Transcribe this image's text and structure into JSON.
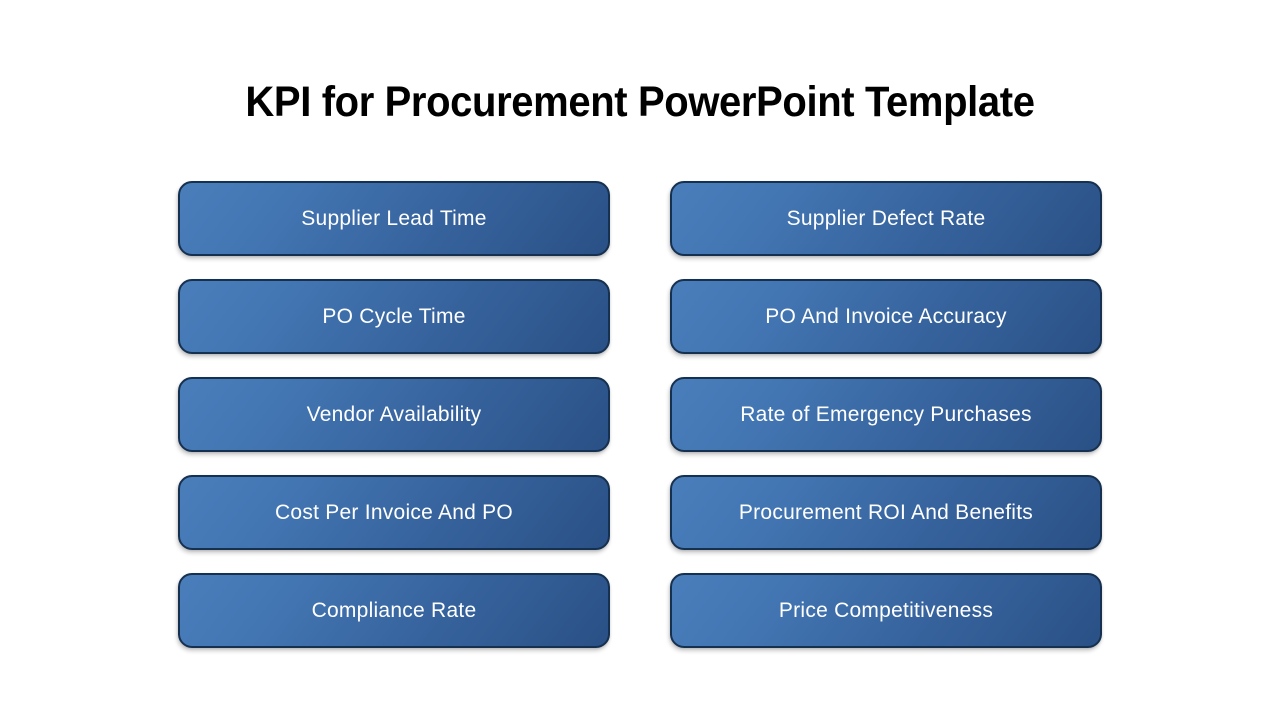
{
  "slide": {
    "title": "KPI for Procurement PowerPoint Template",
    "background_color": "#ffffff",
    "title_color": "#000000"
  },
  "theme": {
    "card_gradient_start": "#4a7ebb",
    "card_gradient_end": "#2a5186",
    "card_border_color": "#16304f",
    "card_label_color": "#ffffff"
  },
  "kpi_cards": [
    {
      "label": "Supplier Lead Time",
      "column": "left",
      "row": 1
    },
    {
      "label": "Supplier Defect Rate",
      "column": "right",
      "row": 1
    },
    {
      "label": "PO Cycle Time",
      "column": "left",
      "row": 2
    },
    {
      "label": "PO And Invoice Accuracy",
      "column": "right",
      "row": 2
    },
    {
      "label": "Vendor Availability",
      "column": "left",
      "row": 3
    },
    {
      "label": "Rate of Emergency Purchases",
      "column": "right",
      "row": 3
    },
    {
      "label": "Cost Per Invoice And PO",
      "column": "left",
      "row": 4
    },
    {
      "label": "Procurement ROI And Benefits",
      "column": "right",
      "row": 4
    },
    {
      "label": "Compliance Rate",
      "column": "left",
      "row": 5
    },
    {
      "label": "Price Competitiveness",
      "column": "right",
      "row": 5
    }
  ]
}
